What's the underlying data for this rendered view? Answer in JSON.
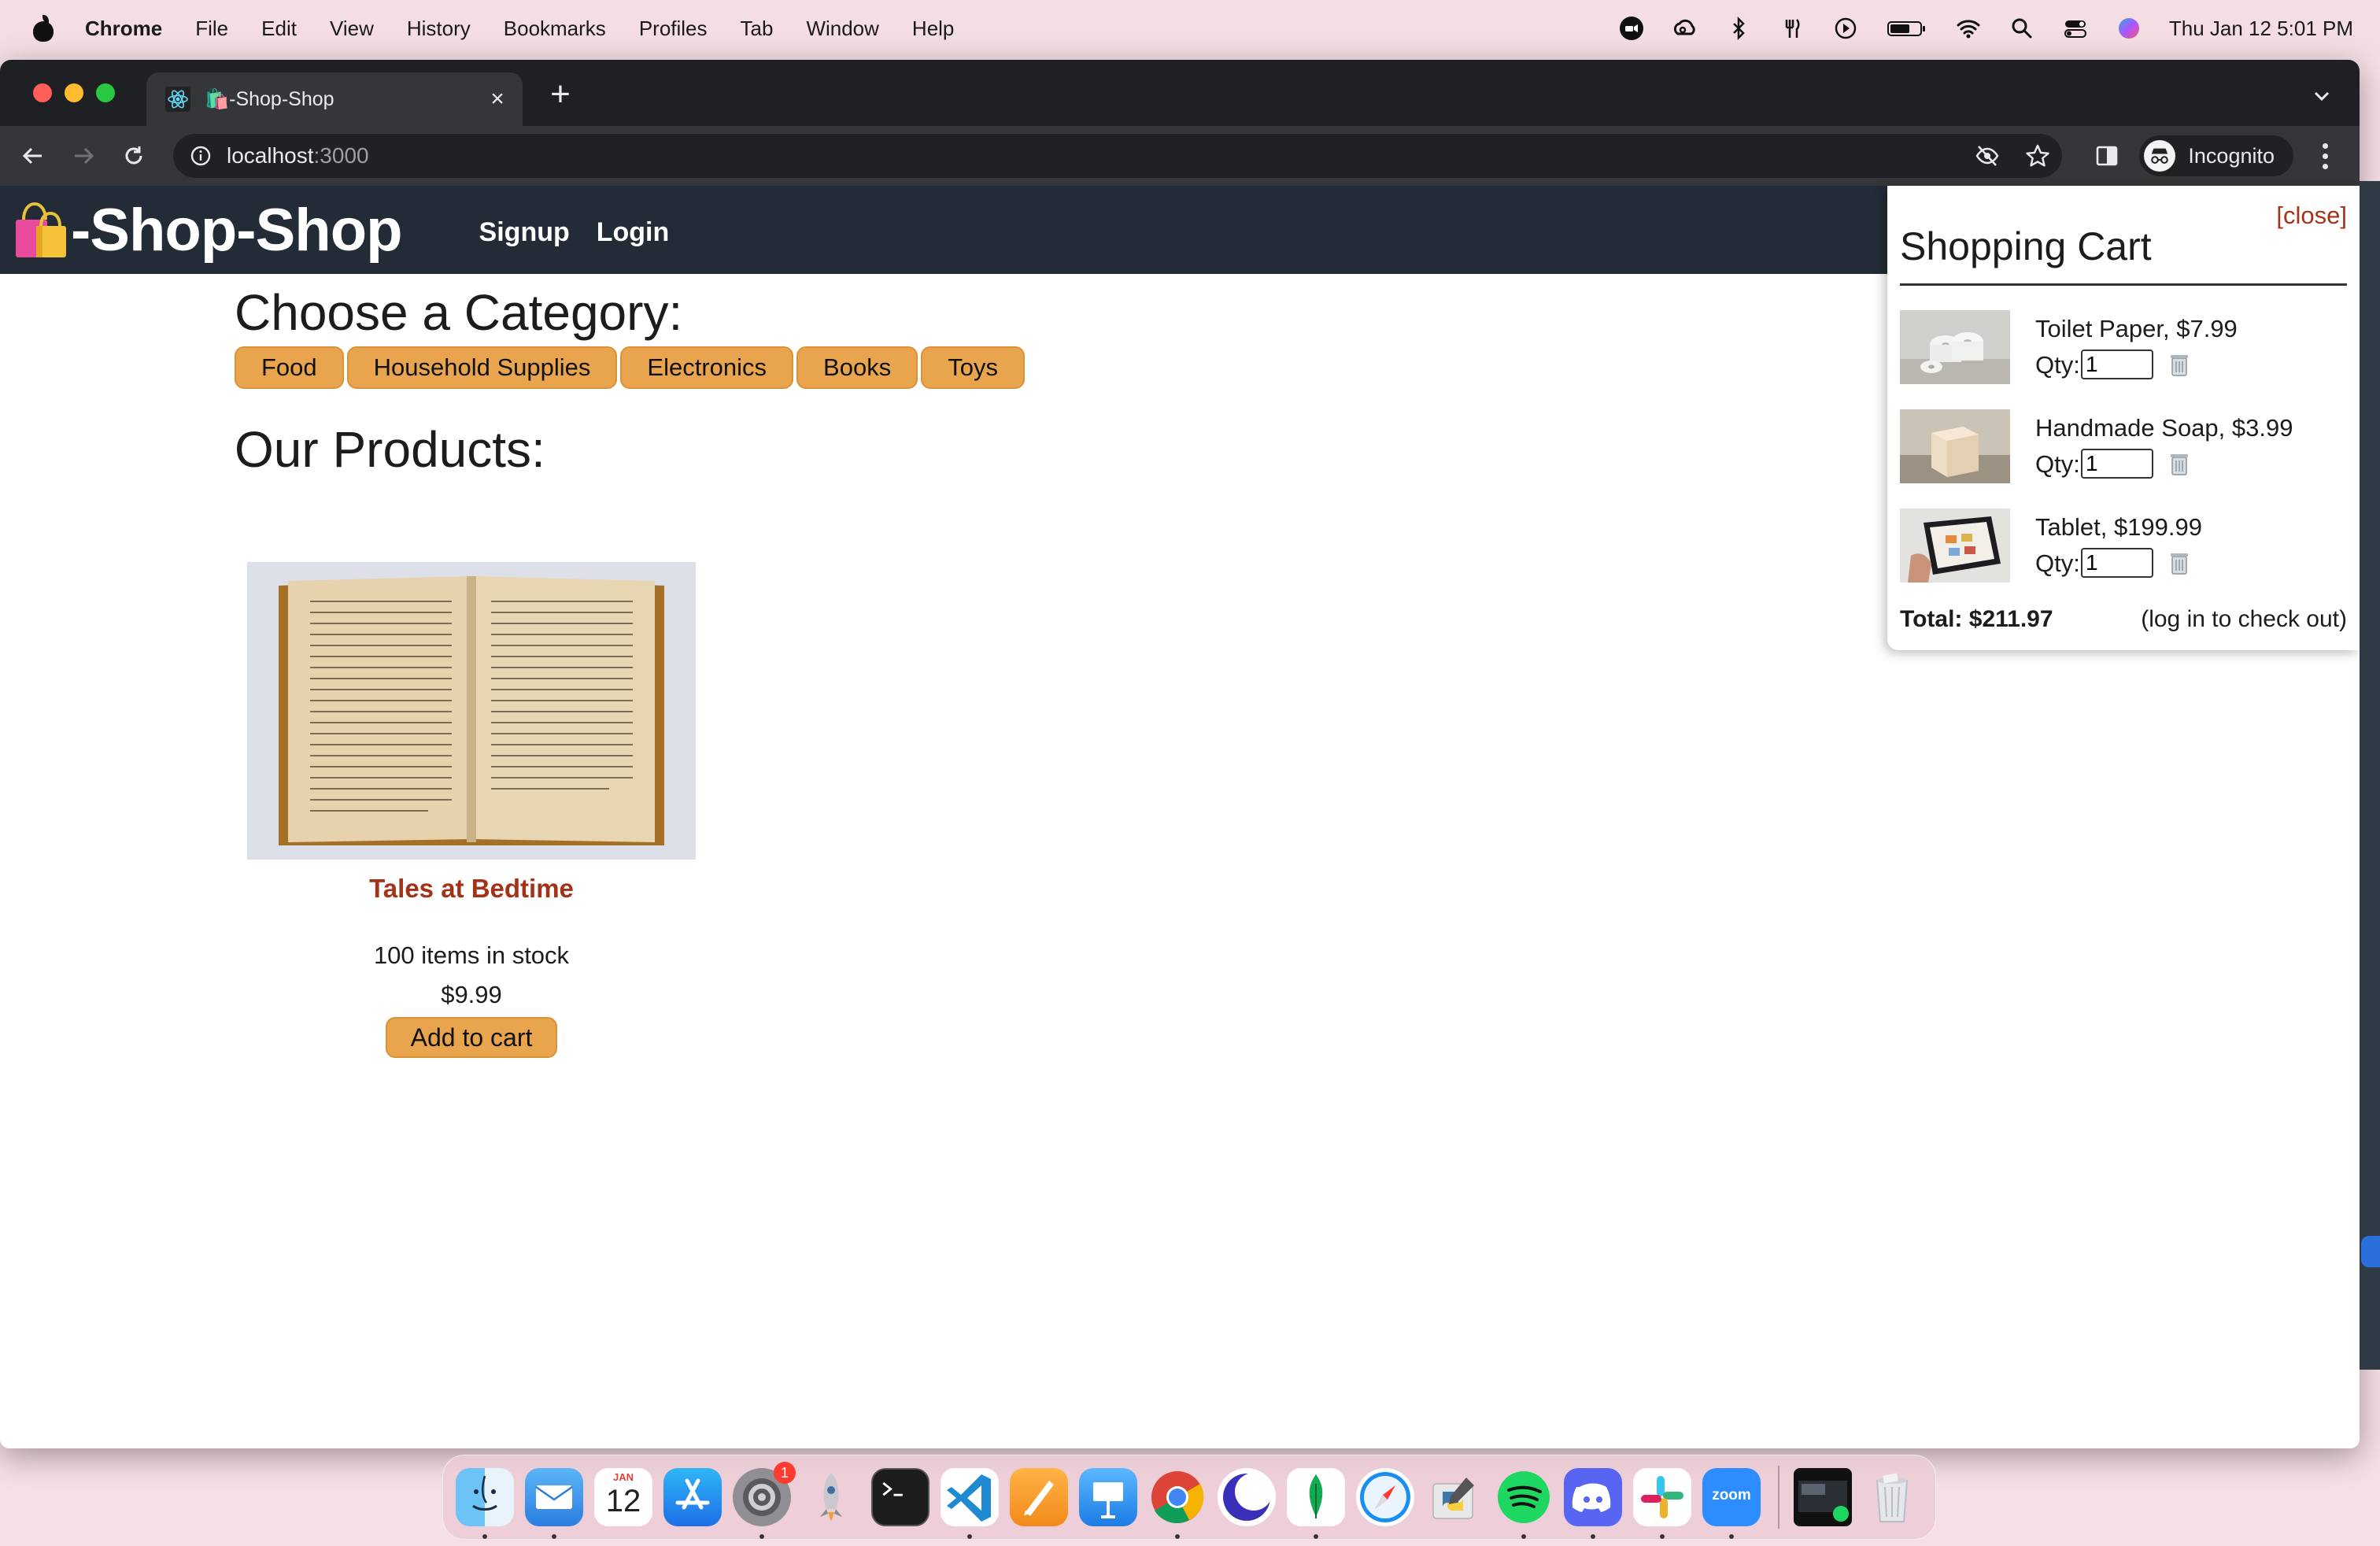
{
  "menubar": {
    "app_name": "Chrome",
    "items": [
      "File",
      "Edit",
      "View",
      "History",
      "Bookmarks",
      "Profiles",
      "Tab",
      "Window",
      "Help"
    ],
    "clock": "Thu Jan 12  5:01 PM"
  },
  "browser": {
    "tab_title": "🛍️-Shop-Shop",
    "url_host": "localhost",
    "url_port": ":3000",
    "profile_label": "Incognito"
  },
  "site": {
    "logo_text": "-Shop-Shop",
    "nav": {
      "signup": "Signup",
      "login": "Login"
    }
  },
  "categories": {
    "title": "Choose a Category:",
    "items": [
      "Food",
      "Household Supplies",
      "Electronics",
      "Books",
      "Toys"
    ]
  },
  "products": {
    "title": "Our Products:",
    "items": [
      {
        "name": "Tales at Bedtime",
        "stock": "100 items in stock",
        "price": "$9.99",
        "button": "Add to cart"
      }
    ]
  },
  "cart": {
    "close_label": "[close]",
    "title": "Shopping Cart",
    "qty_label": "Qty:",
    "items": [
      {
        "title": "Toilet Paper, $7.99",
        "qty": "1"
      },
      {
        "title": "Handmade Soap, $3.99",
        "qty": "1"
      },
      {
        "title": "Tablet, $199.99",
        "qty": "1"
      }
    ],
    "total": "Total: $211.97",
    "checkout_note": "(log in to check out)"
  },
  "dock": {
    "calendar_month": "JAN",
    "calendar_day": "12",
    "settings_badge": "1",
    "zoom_label": "zoom"
  },
  "colors": {
    "accent": "#e8a54e",
    "header_bg": "#222b36",
    "link_red": "#a33218"
  }
}
